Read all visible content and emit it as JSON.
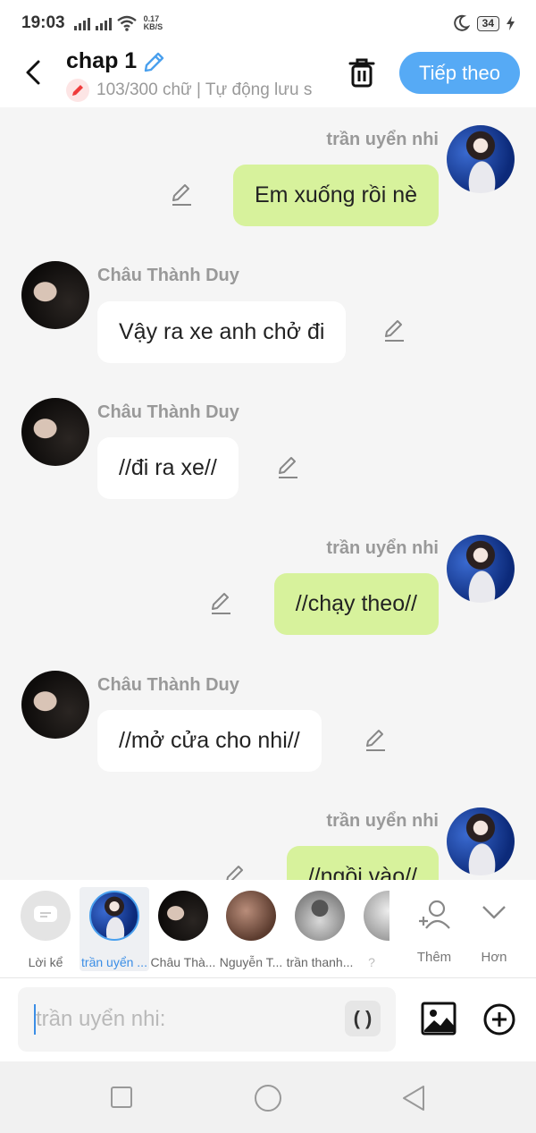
{
  "status_bar": {
    "time": "19:03",
    "net_speed_value": "0.17",
    "net_speed_unit": "KB/S",
    "battery": "34"
  },
  "header": {
    "title": "chap 1",
    "subtitle": "103/300 chữ | Tự động lưu s",
    "next_label": "Tiếp theo"
  },
  "messages": [
    {
      "side": "right",
      "sender": "trần uyển nhi",
      "text": "Em xuống rồi nè"
    },
    {
      "side": "left",
      "sender": "Châu Thành Duy",
      "text": "Vậy ra xe anh chở đi"
    },
    {
      "side": "left",
      "sender": "Châu Thành Duy",
      "text": "//đi ra xe//"
    },
    {
      "side": "right",
      "sender": "trần uyển nhi",
      "text": "//chạy theo//"
    },
    {
      "side": "left",
      "sender": "Châu Thành Duy",
      "text": "//mở cửa cho nhi//"
    },
    {
      "side": "right",
      "sender": "trần uyển nhi",
      "text": "//ngồi vào//"
    }
  ],
  "cast": {
    "items": [
      {
        "label": "Lời kể",
        "icon": "narration-icon"
      },
      {
        "label": "trần uyển ...",
        "selected": true
      },
      {
        "label": "Châu Thà..."
      },
      {
        "label": "Nguyễn T..."
      },
      {
        "label": "trần thanh..."
      },
      {
        "label": "?"
      }
    ],
    "add_label": "Thêm",
    "more_label": "Hơn"
  },
  "input": {
    "placeholder": "trần uyển nhi:",
    "paren_label": "( )"
  },
  "colors": {
    "accent": "#56aaf5",
    "my_bubble": "#d7f29c",
    "other_bubble": "#ffffff",
    "background": "#f5f5f5"
  }
}
